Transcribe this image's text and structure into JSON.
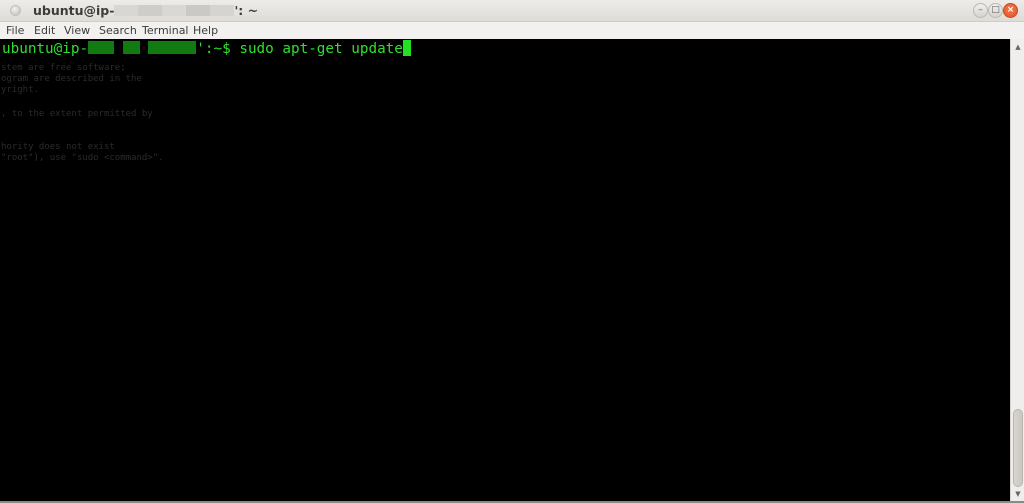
{
  "window": {
    "title_prefix": "ubuntu@ip-",
    "title_suffix": "': ~",
    "buttons": {
      "minimize": "–",
      "maximize": "□",
      "close": "×"
    }
  },
  "menu": [
    {
      "label": "File"
    },
    {
      "label": "Edit"
    },
    {
      "label": "View"
    },
    {
      "label": "Search"
    },
    {
      "label": "Terminal"
    },
    {
      "label": "Help"
    }
  ],
  "terminal": {
    "prompt_user": "ubuntu@ip-",
    "prompt_tail": "':~$ ",
    "command": "sudo apt-get update",
    "ghost_lines": [
      "stem are free software;",
      "ogram are described in the",
      "yright.",
      "",
      ", to the extent permitted by",
      "",
      "",
      "hority does not exist",
      "\"root\"), use \"sudo <command>\"."
    ],
    "colors": {
      "prompt": "#2ee02e",
      "background": "#000000"
    }
  },
  "scrollbar": {
    "up_arrow": "▲",
    "down_arrow": "▼"
  }
}
